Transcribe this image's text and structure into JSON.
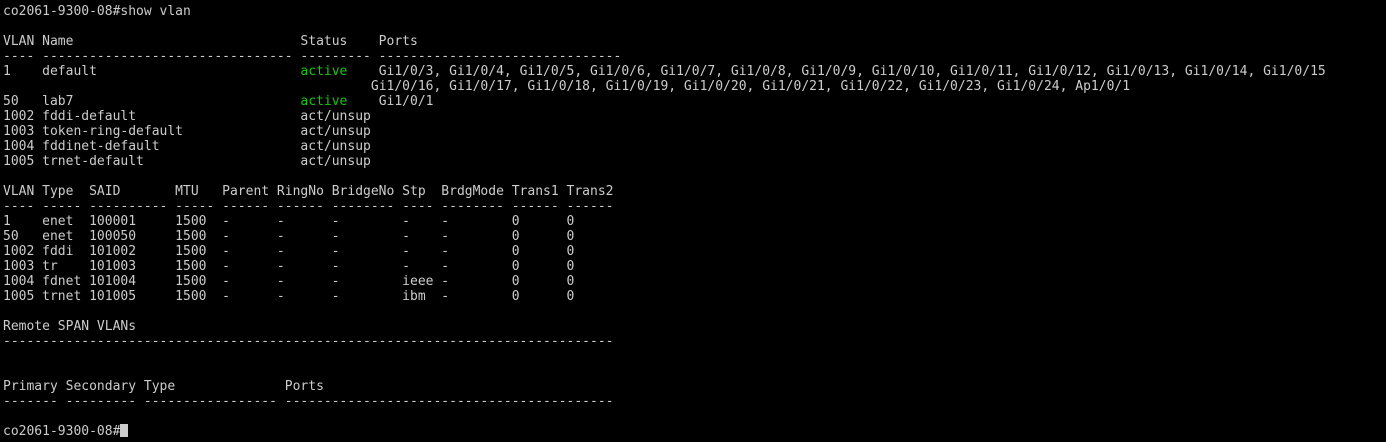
{
  "terminal": {
    "command_line": "co2061-9300-08#show vlan",
    "vlan_table": {
      "header": "VLAN Name                             Status    Ports",
      "separator": "---- -------------------------------- --------- -------------------------------",
      "rows": [
        {
          "prefix": "1    default                          ",
          "status": "active",
          "ports": "    Gi1/0/3, Gi1/0/4, Gi1/0/5, Gi1/0/6, Gi1/0/7, Gi1/0/8, Gi1/0/9, Gi1/0/10, Gi1/0/11, Gi1/0/12, Gi1/0/13, Gi1/0/14, Gi1/0/15"
        },
        {
          "prefix": "                                      ",
          "status": "",
          "ports": "         Gi1/0/16, Gi1/0/17, Gi1/0/18, Gi1/0/19, Gi1/0/20, Gi1/0/21, Gi1/0/22, Gi1/0/23, Gi1/0/24, Ap1/0/1"
        },
        {
          "prefix": "50   lab7                             ",
          "status": "active",
          "ports": "    Gi1/0/1"
        },
        {
          "prefix": "1002 fddi-default                     ",
          "status": "act/unsup",
          "ports": ""
        },
        {
          "prefix": "1003 token-ring-default               ",
          "status": "act/unsup",
          "ports": ""
        },
        {
          "prefix": "1004 fddinet-default                  ",
          "status": "act/unsup",
          "ports": ""
        },
        {
          "prefix": "1005 trnet-default                    ",
          "status": "act/unsup",
          "ports": ""
        }
      ]
    },
    "type_table": {
      "header": "VLAN Type  SAID       MTU   Parent RingNo BridgeNo Stp  BrdgMode Trans1 Trans2",
      "separator": "---- ----- ---------- ----- ------ ------ -------- ---- -------- ------ ------",
      "rows": [
        "1    enet  100001     1500  -      -      -        -    -        0      0",
        "50   enet  100050     1500  -      -      -        -    -        0      0",
        "1002 fddi  101002     1500  -      -      -        -    -        0      0",
        "1003 tr    101003     1500  -      -      -        -    -        0      0",
        "1004 fdnet 101004     1500  -      -      -        ieee -        0      0",
        "1005 trnet 101005     1500  -      -      -        ibm  -        0      0"
      ]
    },
    "remote_span": {
      "title": "Remote SPAN VLANs",
      "separator": "------------------------------------------------------------------------------"
    },
    "pvlan_table": {
      "header": "Primary Secondary Type              Ports",
      "separator": "------- --------- ----------------- ------------------------------------------"
    },
    "prompt": "co2061-9300-08#"
  }
}
